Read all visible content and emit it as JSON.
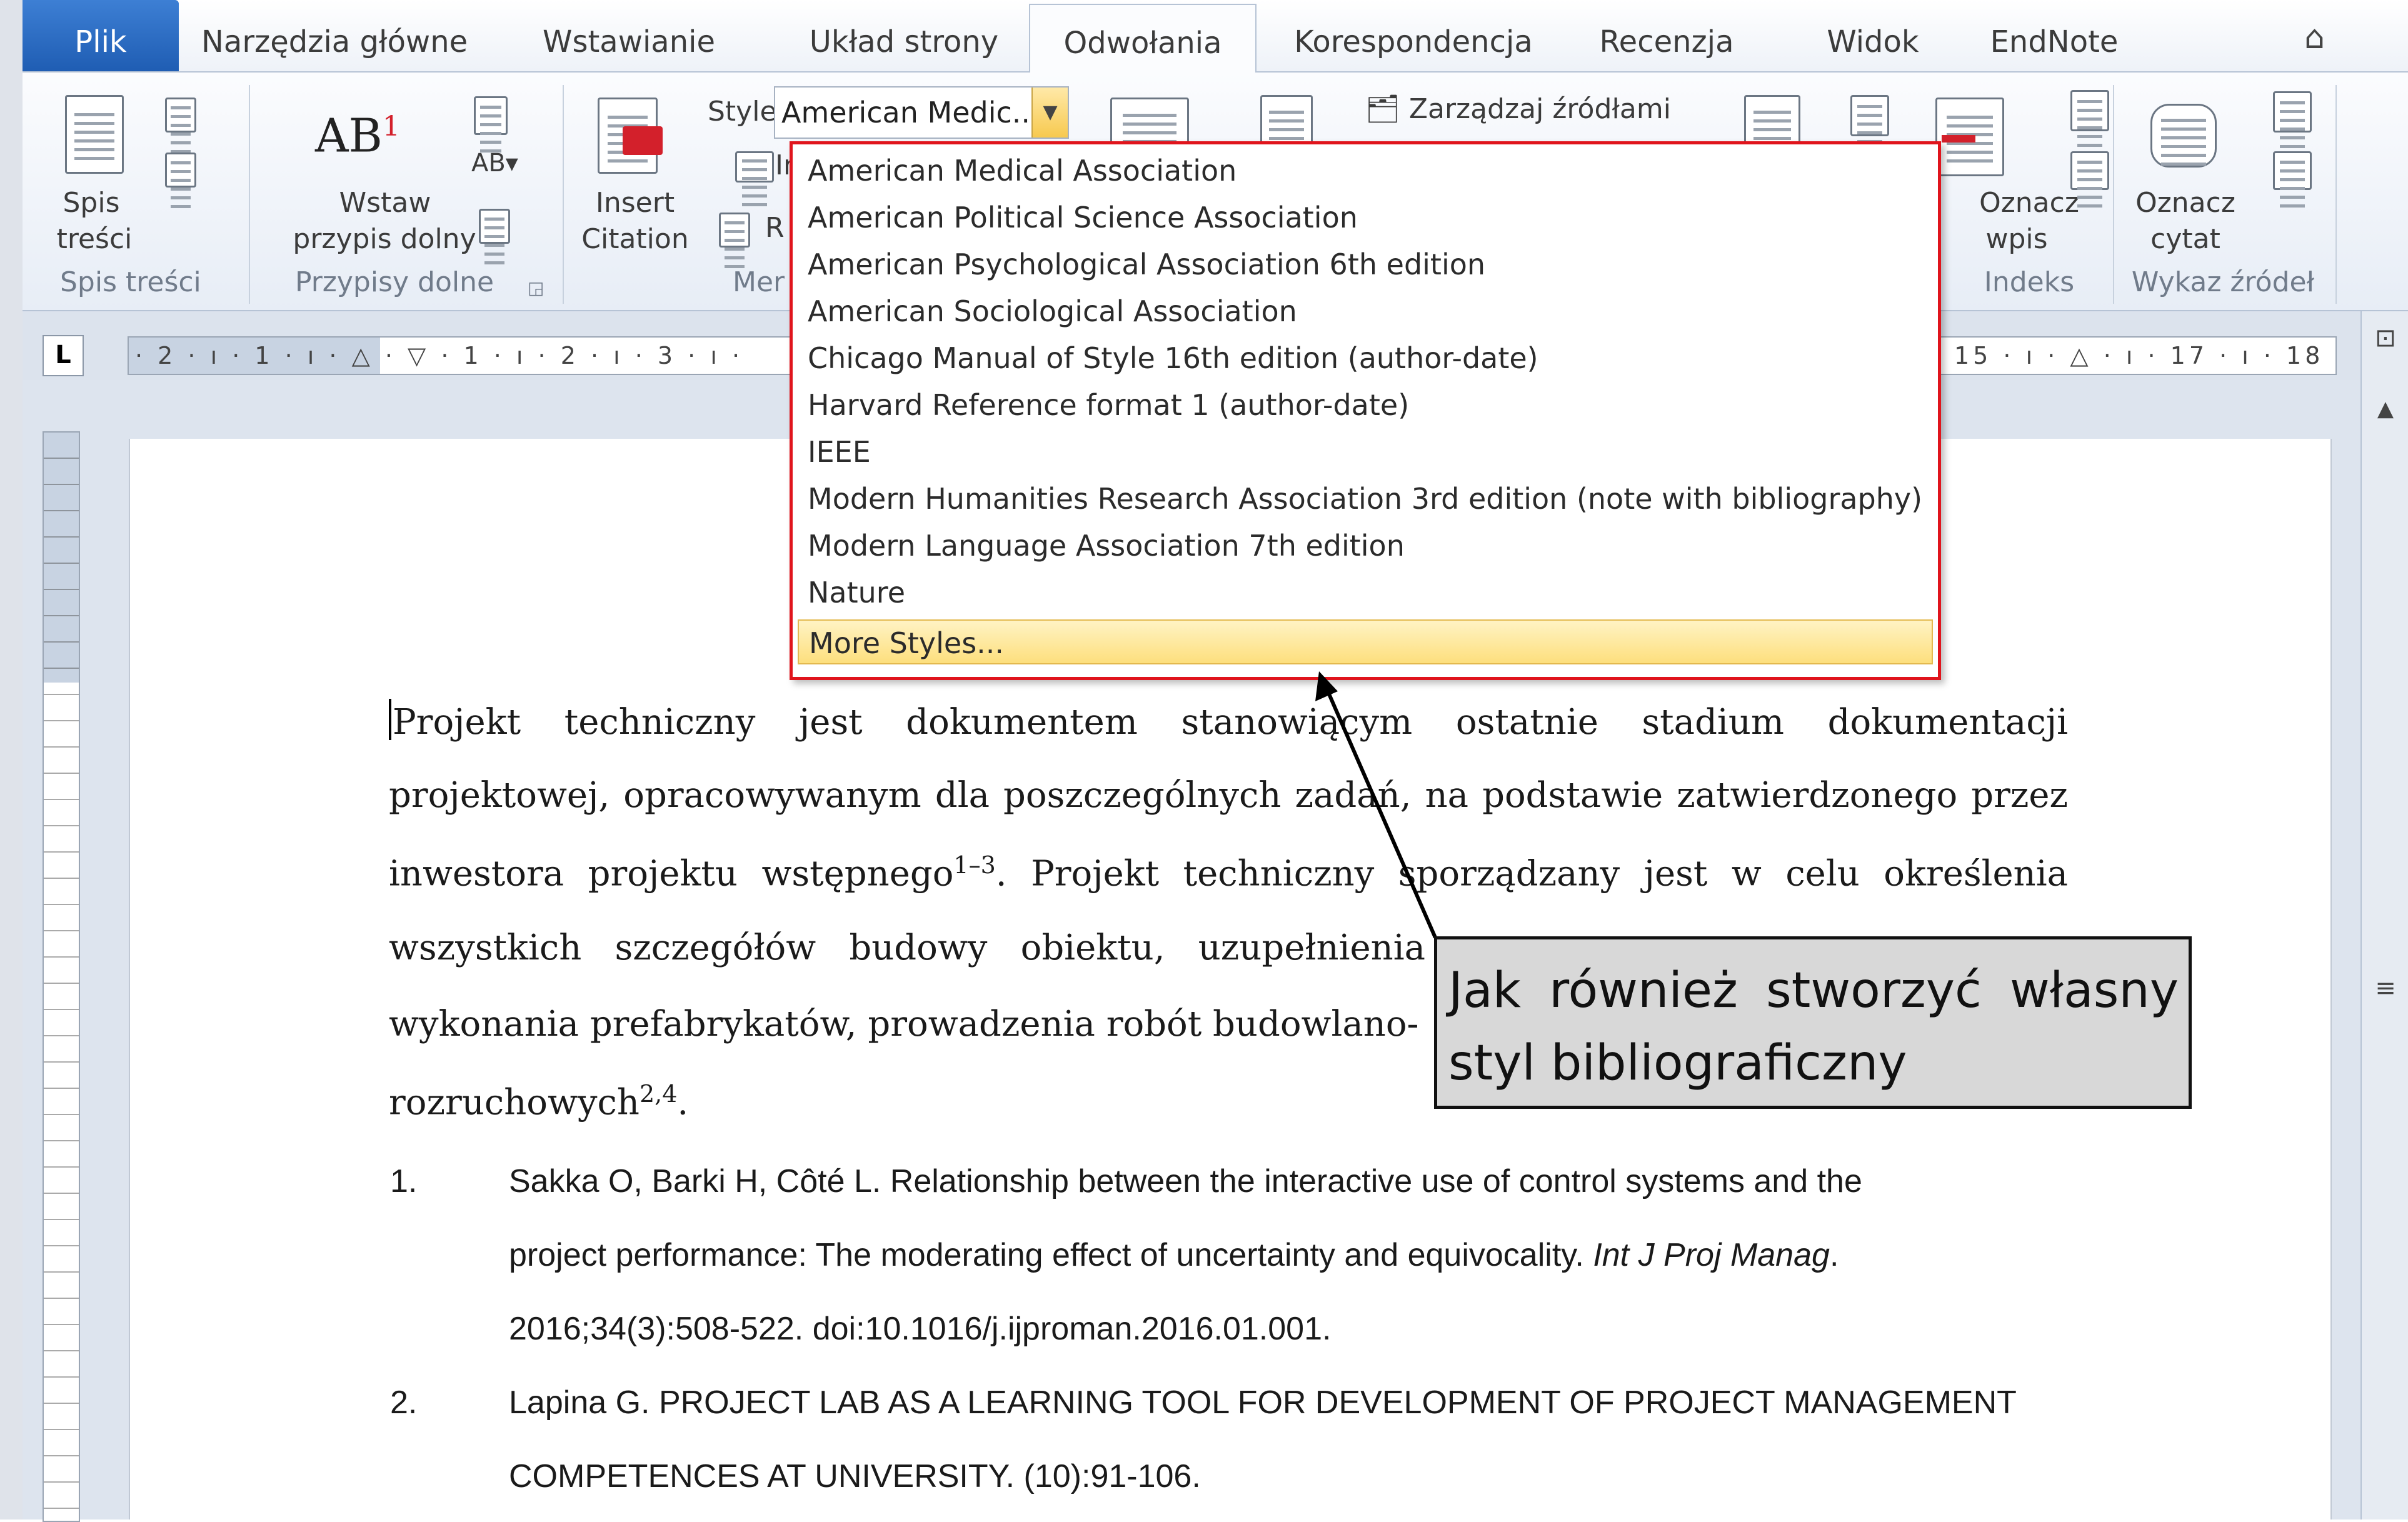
{
  "tabs": [
    {
      "label": "Plik"
    },
    {
      "label": "Narzędzia główne"
    },
    {
      "label": "Wstawianie"
    },
    {
      "label": "Układ strony"
    },
    {
      "label": "Odwołania"
    },
    {
      "label": "Korespondencja"
    },
    {
      "label": "Recenzja"
    },
    {
      "label": "Widok"
    },
    {
      "label": "EndNote"
    }
  ],
  "help_label": "?",
  "ribbon": {
    "toc": {
      "button_line1": "Spis",
      "button_line2": "treści",
      "group_label": "Spis treści"
    },
    "footnotes": {
      "button_line1": "Wstaw",
      "button_line2": "przypis dolny",
      "superscript": "1",
      "ab": "AB",
      "group_label": "Przypisy dolne"
    },
    "citations": {
      "insert_line1": "Insert",
      "insert_line2": "Citation",
      "style_label": "Style:",
      "style_value": "American Medic...",
      "manage_sources": "Zarządzaj źródłami",
      "partial_a": "In",
      "partial_b": "R",
      "group_label_partial": "Mer"
    },
    "index": {
      "button_line1": "Oznacz",
      "button_line2": "wpis",
      "group_label": "Indeks"
    },
    "authorities": {
      "button_line1": "Oznacz",
      "button_line2": "cytat",
      "group_label": "Wykaz źródeł"
    }
  },
  "ruler": {
    "left_text": "· 2 · ı · 1 · ı · △ · ▽ · 1 · ı · 2 · ı · 3 · ı ·",
    "right_text": "15 · ı · △ · ı · 17 · ı · 18 ·",
    "corner": "L"
  },
  "style_dropdown": {
    "items": [
      "American Medical Association",
      "American Political Science Association",
      "American Psychological Association 6th edition",
      "American Sociological Association",
      "Chicago Manual of Style 16th edition (author-date)",
      "Harvard Reference format 1 (author-date)",
      "IEEE",
      "Modern Humanities Research Association 3rd edition (note with bibliography)",
      "Modern Language Association 7th edition",
      "Nature"
    ],
    "more": "More Styles..."
  },
  "document": {
    "p1_line1": "Projekt techniczny jest dokumentem stanowiącym ostatnie stadium dokumentacji",
    "p1_line2": "projektowej, opracowywanym dla poszczególnych zadań, na podstawie zatwierdzonego przez",
    "p1_line3a": "inwestora projektu wstępnego",
    "p1_line3_sup": "1–3",
    "p1_line3b": ". Projekt techniczny sporządzany jest w celu określenia",
    "p1_line4": "wszystkich szczegółów budowy obiektu, uzupełnienia",
    "p1_line5": "wykonania prefabrykatów, prowadzenia robót budowlano-",
    "p1_line6a": "rozruchowych",
    "p1_line6_sup": "2,4",
    "p1_line6b": ".",
    "references": [
      {
        "num": "1.",
        "line1": "Sakka O, Barki H, Côté L. Relationship between the interactive use of control systems and the",
        "line2a": "project performance: The moderating effect of uncertainty and equivocality. ",
        "line2_italic": "Int J Proj Manag",
        "line2b": ".",
        "line3": "2016;34(3):508-522.  doi:10.1016/j.ijproman.2016.01.001."
      },
      {
        "num": "2.",
        "line1": "Lapina G. PROJECT LAB AS A LEARNING TOOL FOR DEVELOPMENT OF PROJECT MANAGEMENT",
        "line2": "COMPETENCES AT UNIVERSITY. (10):91-106."
      }
    ]
  },
  "callout": {
    "text": "Jak również stworzyć własny styl bibliograficzny"
  },
  "colors": {
    "highlight_border": "#e0141c",
    "file_tab": "#2a6cc2",
    "more_styles_bg": "#fddf7d"
  }
}
